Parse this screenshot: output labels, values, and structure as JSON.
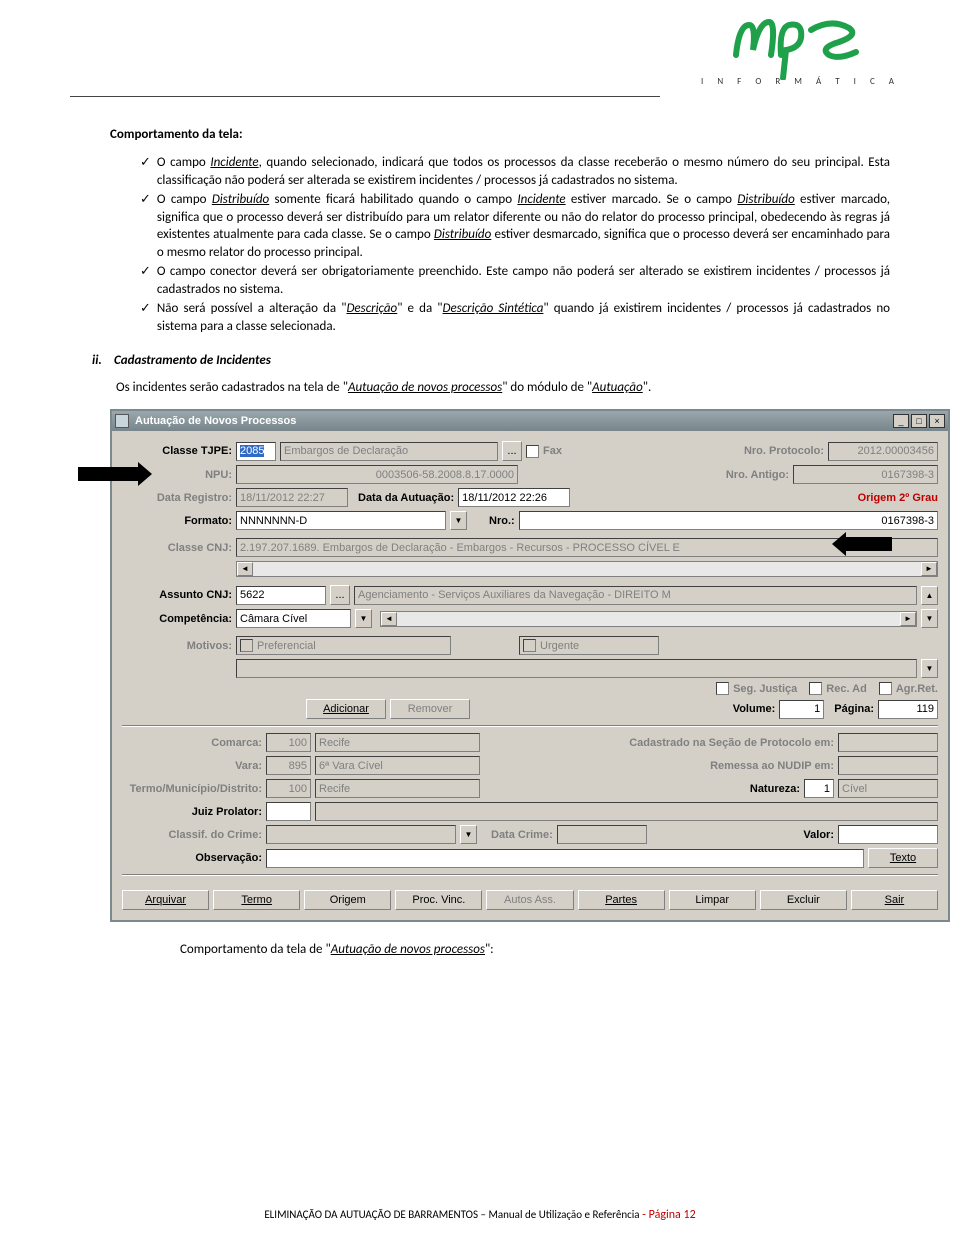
{
  "header": {
    "logo_text": "I N F O R M Á T I C A"
  },
  "doc": {
    "section_title": "Comportamento da tela:",
    "b1a": "O campo ",
    "b1u": "Incidente",
    "b1b": ", quando selecionado, indicará que todos os processos da classe receberão o mesmo número do seu principal. Esta classificação não poderá ser alterada se existirem incidentes / processos já cadastrados no sistema.",
    "b2a": "O campo ",
    "b2u1": "Distribuído",
    "b2b": " somente ficará habilitado quando o campo ",
    "b2u2": "Incidente",
    "b2c": " estiver marcado. Se o campo ",
    "b2u3": "Distribuído",
    "b2d": " estiver marcado, significa que o processo deverá ser distribuído para um relator diferente ou não do relator do processo principal, obedecendo às regras já existentes atualmente para cada classe. Se o campo ",
    "b2u4": "Distribuído",
    "b2e": " estiver desmarcado, significa que o processo deverá ser encaminhado para o mesmo relator do processo principal.",
    "b3": "O campo conector deverá ser obrigatoriamente preenchido. Este campo não poderá ser alterado se existirem incidentes / processos já cadastrados no sistema.",
    "b4a": "Não será possível a alteração da \"",
    "b4u1": "Descrição",
    "b4b": "\" e da \"",
    "b4u2": "Descrição Sintética",
    "b4c": "\" quando já existirem incidentes / processos já cadastrados no sistema para a classe selecionada.",
    "ii_num": "ii.",
    "ii_title": "Cadastramento de Incidentes",
    "reg_a": "Os incidentes serão cadastrados na tela de \"",
    "reg_u1": "Autuação de novos processos",
    "reg_b": "\" do módulo de \"",
    "reg_u2": "Autuação",
    "reg_c": "\".",
    "below_a": "Comportamento da tela de \"",
    "below_u": "Autuação de novos processos",
    "below_b": "\":"
  },
  "win": {
    "title": "Autuação de Novos Processos",
    "lbl_classe": "Classe TJPE:",
    "classe_cod": "2085",
    "classe_txt": "Embargos de Declaração",
    "fax": "Fax",
    "lbl_protocolo": "Nro. Protocolo:",
    "protocolo": "2012.00003456",
    "lbl_npu": "NPU:",
    "npu": "0003506-58.2008.8.17.0000",
    "lbl_antigo": "Nro. Antigo:",
    "antigo": "0167398-3",
    "lbl_datareg": "Data Registro:",
    "datareg": "18/11/2012 22:27",
    "lbl_dataaut": "Data da Autuação:",
    "dataaut": "18/11/2012 22:26",
    "origem": "Origem 2º Grau",
    "lbl_formato": "Formato:",
    "formato": "NNNNNNN-D",
    "lbl_nro": "Nro.:",
    "nro": "0167398-3",
    "lbl_classecnj": "Classe CNJ:",
    "classecnj": "2.197.207.1689. Embargos de Declaração - Embargos - Recursos - PROCESSO CÍVEL E",
    "lbl_assunto": "Assunto CNJ:",
    "assunto_cod": "5622",
    "assunto_txt": "Agenciamento - Serviços Auxiliares da Navegação - DIREITO M",
    "lbl_comp": "Competência:",
    "comp": "Câmara Cível",
    "lbl_motivos": "Motivos:",
    "preferencial": "Preferencial",
    "urgente": "Urgente",
    "segjust": "Seg. Justiça",
    "recad": "Rec. Ad",
    "agrret": "Agr.Ret.",
    "adicionar": "Adicionar",
    "remover": "Remover",
    "lbl_volume": "Volume:",
    "volume": "1",
    "lbl_pagina": "Página:",
    "pagina": "119",
    "lbl_comarca": "Comarca:",
    "comarca_cod": "100",
    "comarca_txt": "Recife",
    "lbl_cadprot": "Cadastrado na Seção de Protocolo em:",
    "lbl_vara": "Vara:",
    "vara_cod": "895",
    "vara_txt": "6ª Vara Cível",
    "lbl_remnudip": "Remessa ao NUDIP em:",
    "lbl_termo": "Termo/Município/Distrito:",
    "termo_cod": "100",
    "termo_txt": "Recife",
    "lbl_natureza": "Natureza:",
    "nat_cod": "1",
    "nat_txt": "Cível",
    "lbl_juiz": "Juiz Prolator:",
    "lbl_classif": "Classif. do Crime:",
    "lbl_datacrime": "Data Crime:",
    "lbl_valor": "Valor:",
    "lbl_obs": "Observação:",
    "texto": "Texto",
    "btn_arq": "Arquivar",
    "btn_ter": "Termo",
    "btn_ori": "Origem",
    "btn_proc": "Proc. Vinc.",
    "btn_aut": "Autos Ass.",
    "btn_par": "Partes",
    "btn_lim": "Limpar",
    "btn_exc": "Excluir",
    "btn_sair": "Sair"
  },
  "footer": {
    "a": "ELIMINAÇÃO DA AUTUAÇÃO DE BARRAMENTOS – Manual de Utilização e Referência",
    "b": " - Página 12"
  }
}
